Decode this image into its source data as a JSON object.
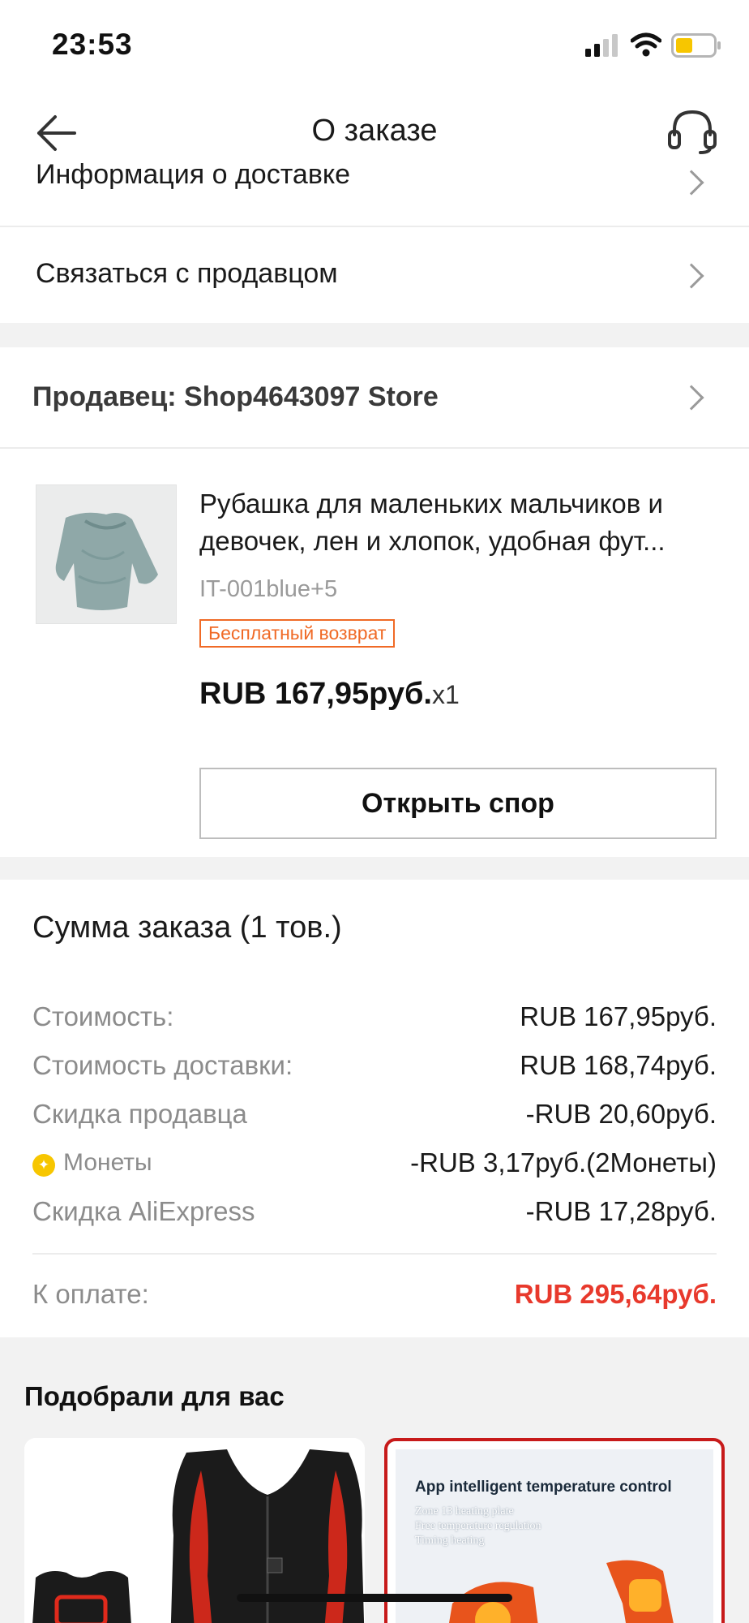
{
  "status": {
    "time": "23:53"
  },
  "header": {
    "title": "О заказе"
  },
  "rows": {
    "delivery_info": "Информация о доставке",
    "contact_seller": "Связаться с продавцом"
  },
  "seller": {
    "label": "Продавец: Shop4643097 Store"
  },
  "product": {
    "title": "Рубашка для маленьких мальчиков и девочек, лен и хлопок, удобная фут...",
    "sku": "IT-001blue+5",
    "badge": "Бесплатный возврат",
    "price": "RUB 167,95руб.",
    "qty": "x1",
    "dispute_button": "Открыть спор"
  },
  "summary": {
    "title": "Сумма заказа (1 тов.)",
    "lines": [
      {
        "label": "Стоимость:",
        "value": "RUB 167,95руб."
      },
      {
        "label": "Стоимость доставки:",
        "value": "RUB 168,74руб."
      },
      {
        "label": "Скидка продавца",
        "value": "-RUB 20,60руб."
      },
      {
        "label": "Монеты",
        "value": "-RUB 3,17руб.(2Монеты)"
      },
      {
        "label": "Скидка AliExpress",
        "value": "-RUB 17,28руб."
      }
    ],
    "total_label": "К оплате:",
    "total_value": "RUB 295,64руб."
  },
  "recommendations": {
    "title": "Подобрали для вас",
    "card2": {
      "headline": "App intelligent temperature control",
      "lines": [
        "Zone 13 heating plate",
        "Free temperature regulation",
        "Timing heating"
      ]
    }
  },
  "colors": {
    "accent_red": "#e8392c",
    "badge_orange": "#f06a26",
    "coin_yellow": "#f7c600"
  }
}
